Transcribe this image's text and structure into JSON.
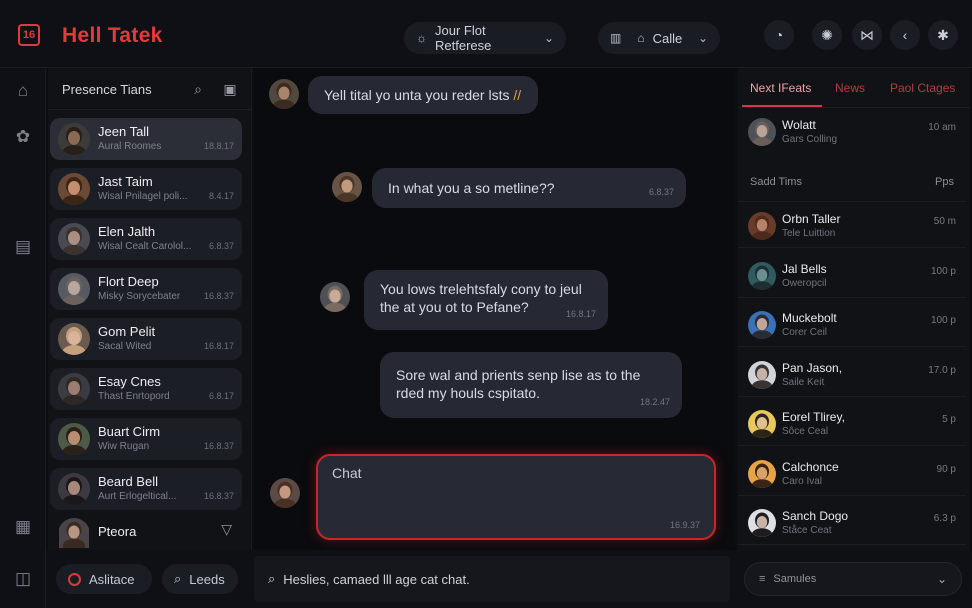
{
  "header": {
    "app_title": "Hell Tatek",
    "logo_glyph": "16",
    "center_pill_label": "Jour Flot Retferese",
    "call_label": "Calle",
    "accent_color": "#e8393a"
  },
  "contacts": {
    "title": "Presence Tians",
    "items": [
      {
        "name": "Jeen Tall",
        "sub": "Aural Roomes",
        "time": "18.8.17",
        "skin": "#8a6a55",
        "hair": "#2a1e18",
        "bg": "#3d3a3a"
      },
      {
        "name": "Jast Taim",
        "sub": "Wisal Pnilagel poli...",
        "time": "8.4.17",
        "skin": "#c48f6c",
        "hair": "#3b2615",
        "bg": "#6b4a35"
      },
      {
        "name": "Elen Jalth",
        "sub": "Wisal Cealt Carolol...",
        "time": "6.8.37",
        "skin": "#a98f83",
        "hair": "#3a3130",
        "bg": "#4a4a52"
      },
      {
        "name": "Flort Deep",
        "sub": "Misky Sorycebater",
        "time": "16.8.37",
        "skin": "#b7a79f",
        "hair": "#6c625d",
        "bg": "#555a63"
      },
      {
        "name": "Gom Pelit",
        "sub": "Sacal Wited",
        "time": "16.8.17",
        "skin": "#d7b49a",
        "hair": "#c4a07c",
        "bg": "#6a5a50"
      },
      {
        "name": "Esay Cnes",
        "sub": "Thast Enrtopord",
        "time": "6.8.17",
        "skin": "#9a7e70",
        "hair": "#2f2724",
        "bg": "#3b3b42"
      },
      {
        "name": "Buart Cirm",
        "sub": "Wiw Rugan",
        "time": "16.8.37",
        "skin": "#b98e70",
        "hair": "#2a2119",
        "bg": "#4d5a48"
      },
      {
        "name": "Beard Bell",
        "sub": "Aurt Erlogeltical...",
        "time": "16.8.37",
        "skin": "#a9877a",
        "hair": "#1c1718",
        "bg": "#3c3a40"
      }
    ],
    "last": {
      "name": "Pteora",
      "skin": "#b99683",
      "hair": "#3b2a22",
      "bg": "#4a4347"
    }
  },
  "chat": {
    "messages": [
      {
        "text": "Yell tital yo unta you reder lsts",
        "highlight": "//",
        "time": "",
        "skin": "#a9846d",
        "hair": "#3a2a20",
        "bg": "#51493e"
      },
      {
        "text": "In what you a so metline??",
        "time": "6.8.37",
        "skin": "#c19a7c",
        "hair": "#4a3526",
        "bg": "#675445"
      },
      {
        "text": "You lows trelehtsfaly cony to jeul the at you ot to Pefane?",
        "time": "16.8.17",
        "skin": "#c7ab98",
        "hair": "#7a6a60",
        "bg": "#4d5155"
      },
      {
        "text": "Sore wal and prients senp lise as to the rded my houls cspitato.",
        "time": "18.2.47",
        "skin": "#a28070",
        "hair": "#2b2220",
        "bg": "#3d3a3b"
      }
    ],
    "compose_placeholder": "Chat",
    "compose_time": "16.9.37",
    "compose_avatar": {
      "skin": "#c39980",
      "hair": "#4a2f24",
      "bg": "#5b4a45"
    }
  },
  "bottom": {
    "left_button": "Aslitace",
    "leads_button": "Leeds",
    "search_text": "Heslies, camaed lll age cat chat.",
    "select_label": "Samules"
  },
  "right_panel": {
    "tabs": [
      "Next IFeats",
      "News",
      "Paol Ctages"
    ],
    "top_item": {
      "name": "Wolatt",
      "sub": "Gars Colling",
      "time": "10 am",
      "skin": "#b8a497",
      "hair": "#6a5f58",
      "bg": "#4d5258"
    },
    "section_left": "Sadd Tims",
    "section_right": "Pps",
    "items": [
      {
        "name": "Orbn Taller",
        "sub": "Tele Luittion",
        "time": "50 m",
        "skin": "#b88268",
        "hair": "#4c2a1c",
        "bg": "#6a3a2a"
      },
      {
        "name": "Jal Bells",
        "sub": "Oweropcil",
        "time": "100 p",
        "skin": "#6a8f93",
        "hair": "#1f2e33",
        "bg": "#2f5a60"
      },
      {
        "name": "Muckebolt",
        "sub": "Corer Ceil",
        "time": "100 p",
        "skin": "#c0a59a",
        "hair": "#2b2b33",
        "bg": "#3a70b8"
      },
      {
        "name": "Pan Jason,",
        "sub": "Saile Keit",
        "time": "17.0 p",
        "skin": "#c4b2a8",
        "hair": "#3a3330",
        "bg": "#d0d4da"
      },
      {
        "name": "Eorel Tlirey,",
        "sub": "Sôce Ceal",
        "time": "5 p",
        "skin": "#e0c08c",
        "hair": "#2c2418",
        "bg": "#e8c75c"
      },
      {
        "name": "Calchonce",
        "sub": "Caro Ival",
        "time": "90 p",
        "skin": "#d9a26a",
        "hair": "#3a2416",
        "bg": "#e7a346"
      },
      {
        "name": "Sanch Dogo",
        "sub": "Ståce Ceat",
        "time": "6.3 p",
        "skin": "#c8b3a7",
        "hair": "#1e1c1f",
        "bg": "#dedfe3"
      }
    ]
  }
}
